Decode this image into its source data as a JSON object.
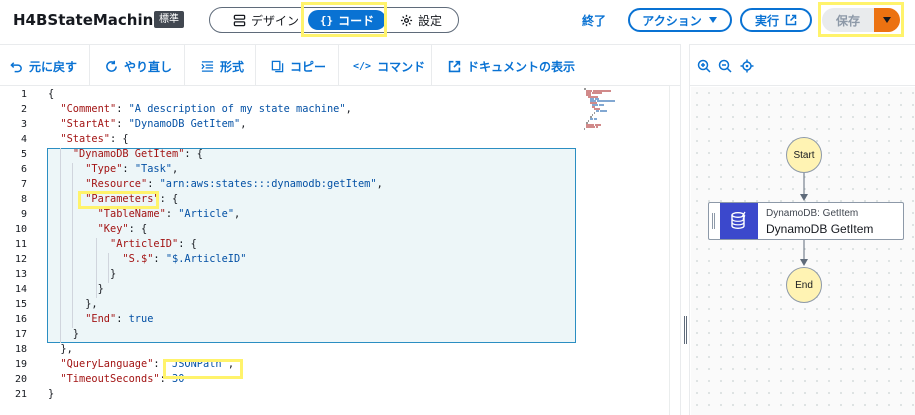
{
  "header": {
    "title": "H4BStateMachine",
    "badge": "標準",
    "modes": {
      "design": "デザイン",
      "code": "コード",
      "settings": "設定",
      "selected": "code"
    },
    "exit_label": "終了",
    "action_label": "アクション",
    "run_label": "実行",
    "save_label": "保存",
    "accent_color": "#0972d3",
    "save_dropdown_color": "#ec7211"
  },
  "toolbar": {
    "undo": "元に戻す",
    "redo": "やり直し",
    "format": "形式",
    "copy": "コピー",
    "command": "コマンド",
    "docs": "ドキュメントの表示"
  },
  "graph_toolbar": {
    "icons": [
      "zoom-in-icon",
      "zoom-out-icon",
      "center-icon"
    ]
  },
  "editor": {
    "line_numbers": [
      "1",
      "2",
      "3",
      "4",
      "5",
      "6",
      "7",
      "8",
      "9",
      "10",
      "11",
      "12",
      "13",
      "14",
      "15",
      "16",
      "17",
      "18",
      "19",
      "20",
      "21"
    ],
    "lines": [
      [
        {
          "t": "{",
          "c": "v"
        }
      ],
      [
        {
          "t": "  ",
          "c": "v"
        },
        {
          "t": "\"Comment\"",
          "c": "k"
        },
        {
          "t": ": ",
          "c": "v"
        },
        {
          "t": "\"A description of my state machine\"",
          "c": "s"
        },
        {
          "t": ",",
          "c": "v"
        }
      ],
      [
        {
          "t": "  ",
          "c": "v"
        },
        {
          "t": "\"StartAt\"",
          "c": "k"
        },
        {
          "t": ": ",
          "c": "v"
        },
        {
          "t": "\"DynamoDB GetItem\"",
          "c": "s"
        },
        {
          "t": ",",
          "c": "v"
        }
      ],
      [
        {
          "t": "  ",
          "c": "v"
        },
        {
          "t": "\"States\"",
          "c": "k"
        },
        {
          "t": ": {",
          "c": "v"
        }
      ],
      [
        {
          "t": "    ",
          "c": "v"
        },
        {
          "t": "\"DynamoDB GetItem\"",
          "c": "k"
        },
        {
          "t": ": {",
          "c": "v"
        }
      ],
      [
        {
          "t": "      ",
          "c": "v"
        },
        {
          "t": "\"Type\"",
          "c": "k"
        },
        {
          "t": ": ",
          "c": "v"
        },
        {
          "t": "\"Task\"",
          "c": "s"
        },
        {
          "t": ",",
          "c": "v"
        }
      ],
      [
        {
          "t": "      ",
          "c": "v"
        },
        {
          "t": "\"Resource\"",
          "c": "k"
        },
        {
          "t": ": ",
          "c": "v"
        },
        {
          "t": "\"arn:aws:states:::dynamodb:getItem\"",
          "c": "s"
        },
        {
          "t": ",",
          "c": "v"
        }
      ],
      [
        {
          "t": "      ",
          "c": "v"
        },
        {
          "t": "\"Parameters\"",
          "c": "k"
        },
        {
          "t": ": {",
          "c": "v"
        }
      ],
      [
        {
          "t": "        ",
          "c": "v"
        },
        {
          "t": "\"TableName\"",
          "c": "k"
        },
        {
          "t": ": ",
          "c": "v"
        },
        {
          "t": "\"Article\"",
          "c": "s"
        },
        {
          "t": ",",
          "c": "v"
        }
      ],
      [
        {
          "t": "        ",
          "c": "v"
        },
        {
          "t": "\"Key\"",
          "c": "k"
        },
        {
          "t": ": {",
          "c": "v"
        }
      ],
      [
        {
          "t": "          ",
          "c": "v"
        },
        {
          "t": "\"ArticleID\"",
          "c": "k"
        },
        {
          "t": ": {",
          "c": "v"
        }
      ],
      [
        {
          "t": "            ",
          "c": "v"
        },
        {
          "t": "\"S.$\"",
          "c": "k"
        },
        {
          "t": ": ",
          "c": "v"
        },
        {
          "t": "\"$.ArticleID\"",
          "c": "s"
        }
      ],
      [
        {
          "t": "          }",
          "c": "v"
        }
      ],
      [
        {
          "t": "        }",
          "c": "v"
        }
      ],
      [
        {
          "t": "      },",
          "c": "v"
        }
      ],
      [
        {
          "t": "      ",
          "c": "v"
        },
        {
          "t": "\"End\"",
          "c": "k"
        },
        {
          "t": ": ",
          "c": "v"
        },
        {
          "t": "true",
          "c": "s"
        }
      ],
      [
        {
          "t": "    }",
          "c": "v"
        }
      ],
      [
        {
          "t": "  },",
          "c": "v"
        }
      ],
      [
        {
          "t": "  ",
          "c": "v"
        },
        {
          "t": "\"QueryLanguage\"",
          "c": "k"
        },
        {
          "t": ": ",
          "c": "v"
        },
        {
          "t": "\"JSONPath\"",
          "c": "s"
        },
        {
          "t": ",",
          "c": "v"
        }
      ],
      [
        {
          "t": "  ",
          "c": "v"
        },
        {
          "t": "\"TimeoutSeconds\"",
          "c": "k"
        },
        {
          "t": ": ",
          "c": "v"
        },
        {
          "t": "30",
          "c": "s"
        }
      ],
      [
        {
          "t": "}",
          "c": "v"
        }
      ]
    ]
  },
  "graph": {
    "start_label": "Start",
    "end_label": "End",
    "task_type": "DynamoDB: GetItem",
    "task_name": "DynamoDB GetItem",
    "node_fill": "#fff3b3",
    "task_icon_color": "#3b48cc"
  }
}
